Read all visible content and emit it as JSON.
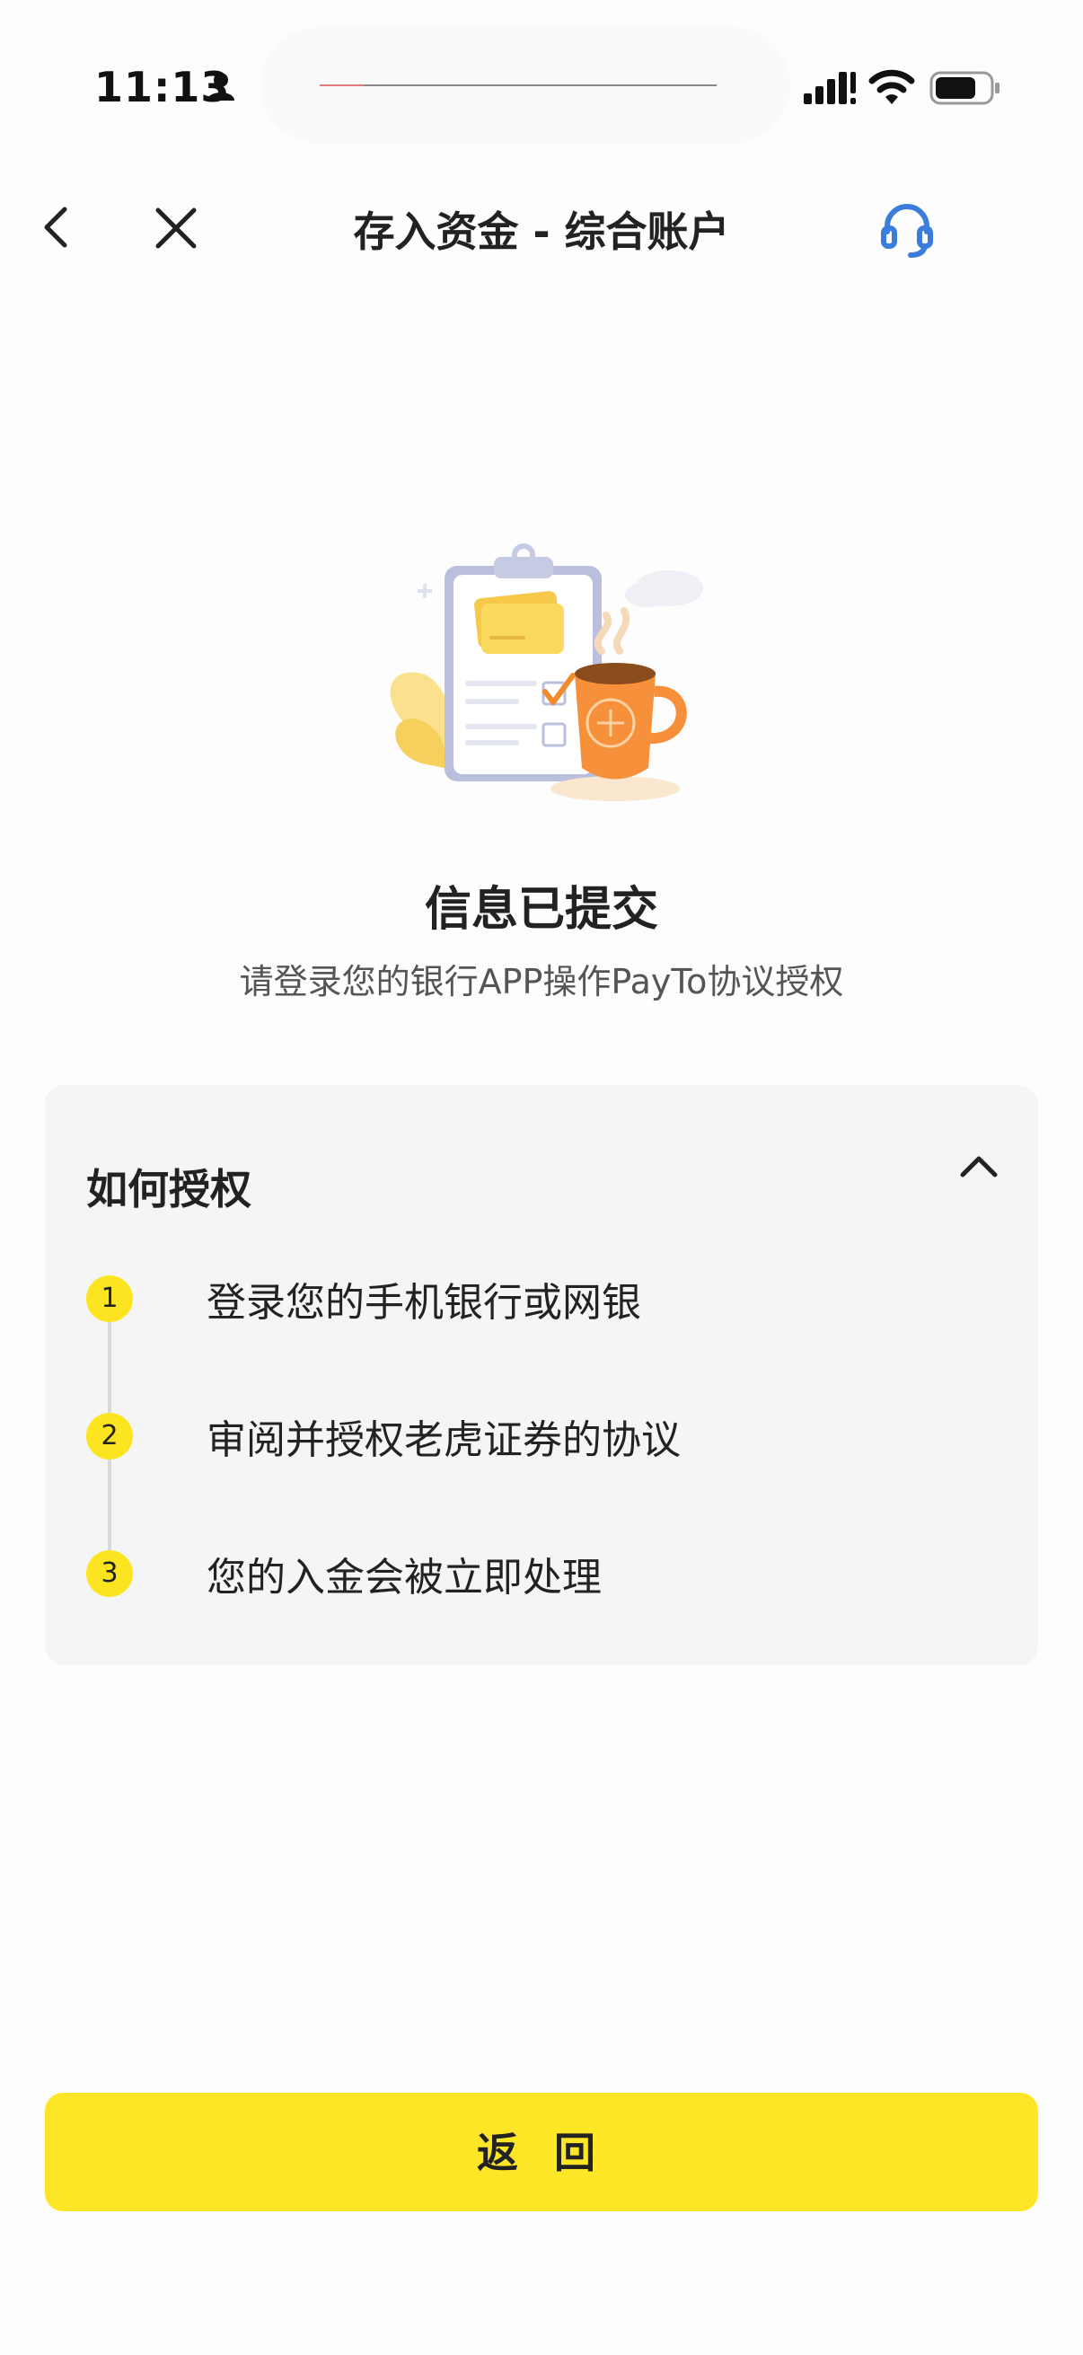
{
  "status_bar": {
    "time": "11:13",
    "icons": [
      "person-icon",
      "signal-icon",
      "wifi-icon",
      "battery-icon"
    ]
  },
  "nav": {
    "title": "存入资金 - 综合账户",
    "icons": [
      "back-icon",
      "close-icon",
      "customer-support-icon"
    ],
    "accent_color": "#3b7ddd"
  },
  "result": {
    "title": "信息已提交",
    "subtitle": "请登录您的银行APP操作PayTo协议授权"
  },
  "howto": {
    "title": "如何授权",
    "expanded": true,
    "steps": [
      {
        "number": "1",
        "text": "登录您的手机银行或网银"
      },
      {
        "number": "2",
        "text": "审阅并授权老虎证券的协议"
      },
      {
        "number": "3",
        "text": "您的入金会被立即处理"
      }
    ]
  },
  "footer": {
    "return_label": "返 回"
  },
  "colors": {
    "primary_yellow": "#fde626",
    "card_bg": "#f5f5f5"
  }
}
